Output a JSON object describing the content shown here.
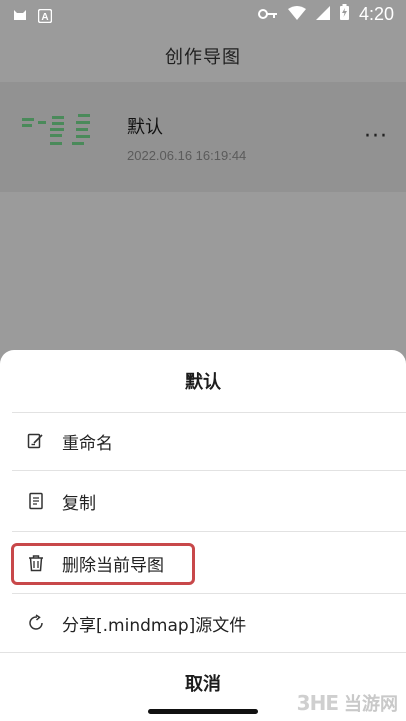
{
  "status_bar": {
    "time": "4:20",
    "icons": [
      "cat-icon",
      "a-badge-icon",
      "vpn-key-icon",
      "wifi-icon",
      "signal-icon",
      "battery-charging-icon"
    ]
  },
  "app": {
    "title": "创作导图",
    "map_item": {
      "title": "默认",
      "date": "2022.06.16 16:19:44",
      "more_icon": "more-icon",
      "more_label": "···"
    }
  },
  "sheet": {
    "title": "默认",
    "options": [
      {
        "label": "重命名",
        "icon": "edit-icon"
      },
      {
        "label": "复制",
        "icon": "copy-icon"
      },
      {
        "label": "删除当前导图",
        "icon": "trash-icon"
      },
      {
        "label": "分享[.mindmap]源文件",
        "icon": "share-icon"
      }
    ],
    "cancel_label": "取消",
    "highlight_color": "#c8484a"
  },
  "watermark": {
    "logo": "3HE",
    "text": "当游网"
  }
}
